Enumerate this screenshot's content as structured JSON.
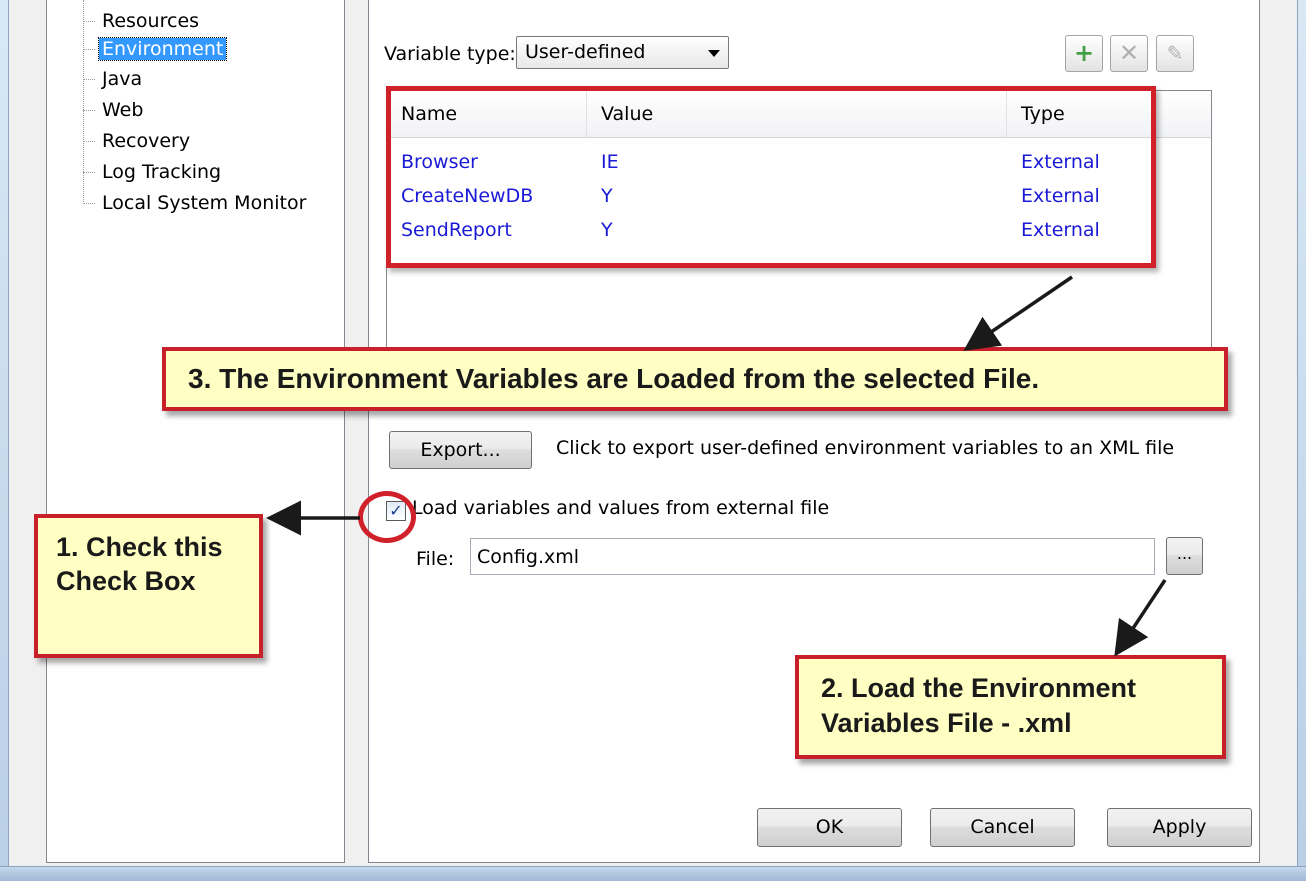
{
  "tree": {
    "items": [
      {
        "label": "Resources",
        "selected": false
      },
      {
        "label": "Environment",
        "selected": true
      },
      {
        "label": "Java",
        "selected": false
      },
      {
        "label": "Web",
        "selected": false
      },
      {
        "label": "Recovery",
        "selected": false
      },
      {
        "label": "Log Tracking",
        "selected": false
      },
      {
        "label": "Local System Monitor",
        "selected": false
      }
    ]
  },
  "variable_type": {
    "label": "Variable type:",
    "value": "User-defined"
  },
  "toolbar": {
    "add_icon": "plus-icon",
    "delete_icon": "x-icon",
    "edit_icon": "pencil-icon"
  },
  "grid": {
    "columns": [
      "Name",
      "Value",
      "Type"
    ],
    "rows": [
      {
        "name": "Browser",
        "value": "IE",
        "type": "External"
      },
      {
        "name": "CreateNewDB",
        "value": "Y",
        "type": "External"
      },
      {
        "name": "SendReport",
        "value": "Y",
        "type": "External"
      }
    ]
  },
  "export": {
    "button_label": "Export...",
    "description": "Click to export user-defined environment variables to an XML file"
  },
  "load_external": {
    "checked": true,
    "label": "Load variables and values from external file"
  },
  "file": {
    "label": "File:",
    "value": "Config.xml",
    "browse_label": "..."
  },
  "dialog_buttons": {
    "ok": "OK",
    "cancel": "Cancel",
    "apply": "Apply"
  },
  "callouts": {
    "step1": "1. Check this Check Box",
    "step2": "2. Load the Environment Variables File - .xml",
    "step3": "3. The Environment Variables are Loaded from the selected File."
  },
  "colors": {
    "callout_border": "#c8202a",
    "callout_fill": "#ffffc4",
    "grid_text": "#1a1ad6",
    "selection": "#3399ff"
  }
}
